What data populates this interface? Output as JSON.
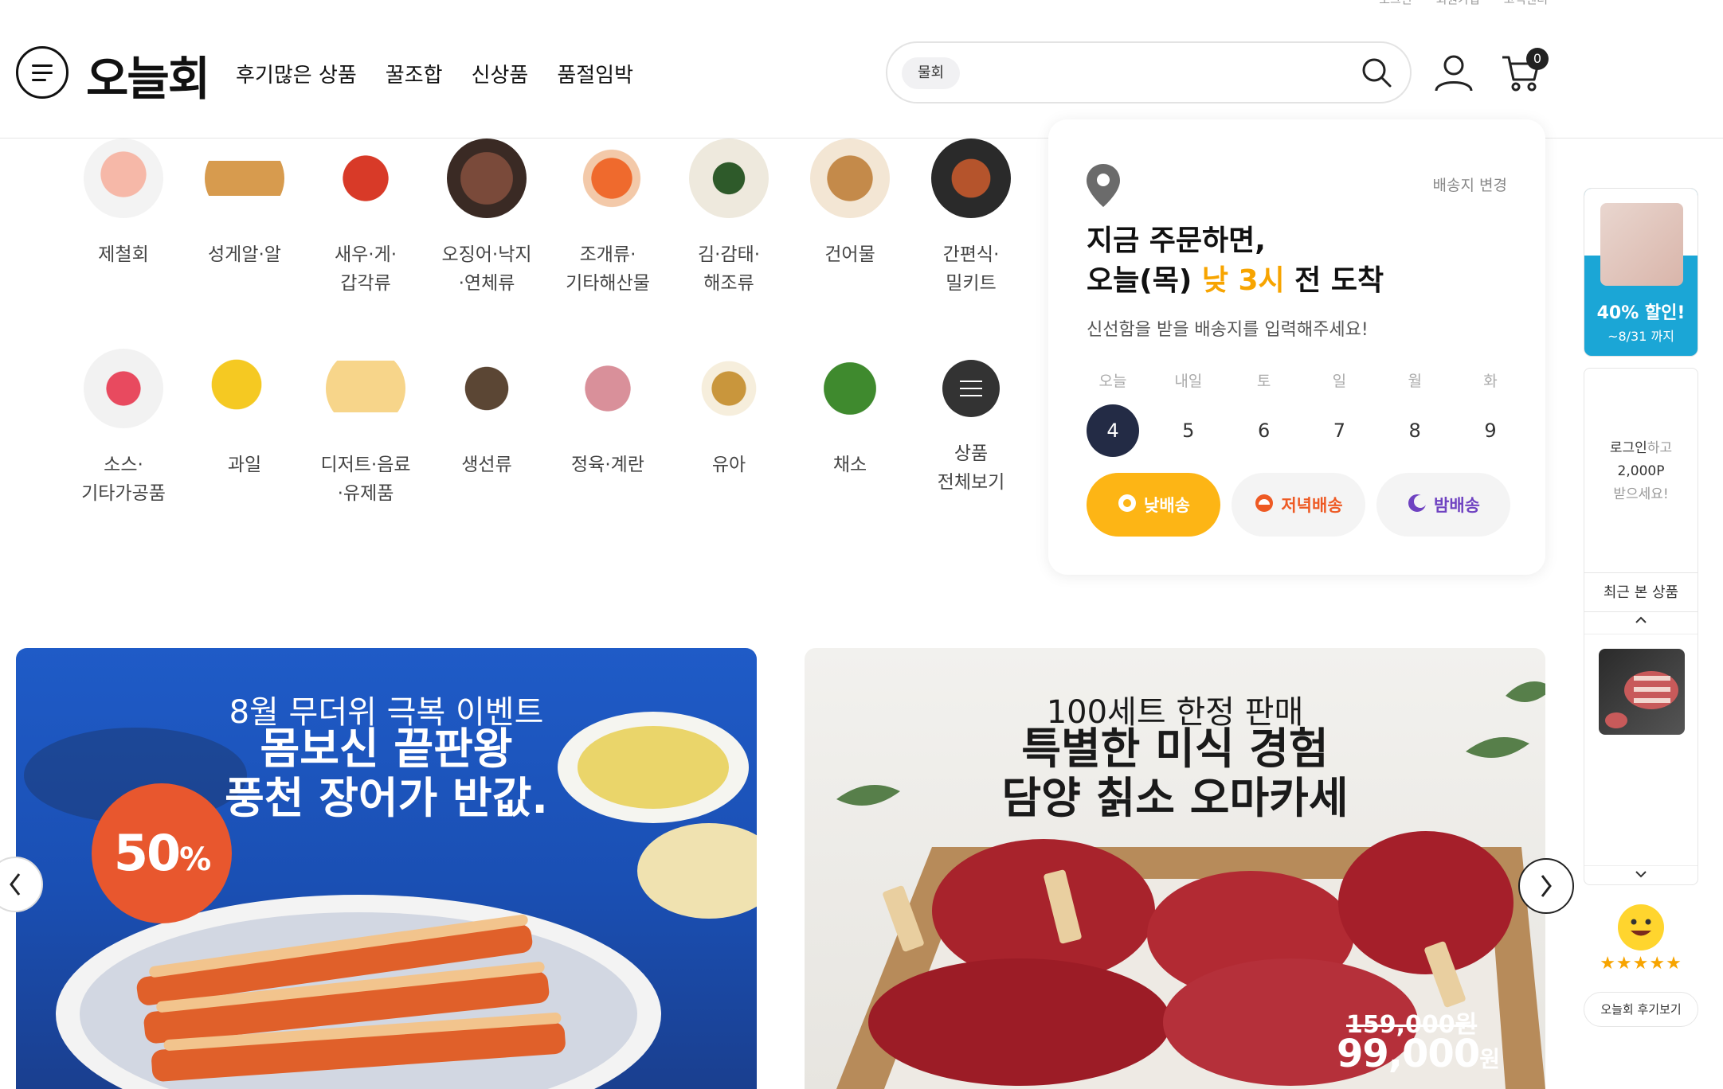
{
  "header": {
    "top_links": [
      "로그인",
      "회원가입",
      "고객센터"
    ],
    "logo": "오늘회",
    "nav": [
      "후기많은 상품",
      "꿀조합",
      "신상품",
      "품절임박"
    ],
    "search": {
      "chip": "물회",
      "placeholder": ""
    },
    "cart_count": "0"
  },
  "categories": [
    {
      "label": "제철회",
      "icon": "sashimi-icon"
    },
    {
      "label": "성게알·알",
      "icon": "sea-urchin-icon"
    },
    {
      "label": "새우·게·\n갑각류",
      "icon": "lobster-icon"
    },
    {
      "label": "오징어·낙지\n·연체류",
      "icon": "octopus-icon"
    },
    {
      "label": "조개류·\n기타해산물",
      "icon": "shellfish-icon"
    },
    {
      "label": "김·감태·\n해조류",
      "icon": "seaweed-icon"
    },
    {
      "label": "건어물",
      "icon": "dried-fish-icon"
    },
    {
      "label": "간편식·\n밀키트",
      "icon": "mealkit-icon"
    },
    {
      "label": "소스·\n기타가공품",
      "icon": "sauce-icon"
    },
    {
      "label": "과일",
      "icon": "fruit-icon"
    },
    {
      "label": "디저트·음료\n·유제품",
      "icon": "drink-icon"
    },
    {
      "label": "생선류",
      "icon": "fish-icon"
    },
    {
      "label": "정육·계란",
      "icon": "meat-icon"
    },
    {
      "label": "유아",
      "icon": "baby-food-icon"
    },
    {
      "label": "채소",
      "icon": "vegetable-icon"
    },
    {
      "label": "상품\n전체보기",
      "icon": "menu-icon"
    }
  ],
  "delivery": {
    "change_link": "배송지 변경",
    "title_line1": "지금 주문하면,",
    "title_pre": "오늘(목) ",
    "title_hi": "낮 3시",
    "title_post": " 전 도착",
    "subtitle": "신선함을 받을 배송지를 입력해주세요!",
    "days": [
      {
        "name": "오늘",
        "date": "4"
      },
      {
        "name": "내일",
        "date": "5"
      },
      {
        "name": "토",
        "date": "6"
      },
      {
        "name": "일",
        "date": "7"
      },
      {
        "name": "월",
        "date": "8"
      },
      {
        "name": "화",
        "date": "9"
      }
    ],
    "slots": [
      "낮배송",
      "저녁배송",
      "밤배송"
    ]
  },
  "banners": [
    {
      "subtitle": "8월 무더위 극복 이벤트",
      "title": "몸보신 끝판왕\n풍천 장어가 반값.",
      "badge": "50",
      "badge_unit": "%"
    },
    {
      "subtitle": "100세트 한정 판매",
      "title": "특별한 미식 경험\n담양 칡소 오마카세",
      "price_old": "159,000원",
      "price_new": "99,000",
      "price_unit": "원"
    }
  ],
  "sidebar": {
    "promo_title": "40% 할인!",
    "promo_sub": "~8/31 까지",
    "login_link": "로그인",
    "login_msg_rest": "하고",
    "login_points": "2,000P",
    "login_msg_end": "받으세요!",
    "recent_title": "최근 본 상품",
    "stars": "★★★★★",
    "review_button": "오늘회 후기보기"
  },
  "colors": {
    "accent_orange": "#f7a400",
    "navy": "#232b45",
    "banner_blue": "#1f5bc7",
    "promo_blue": "#1ba6d6"
  }
}
